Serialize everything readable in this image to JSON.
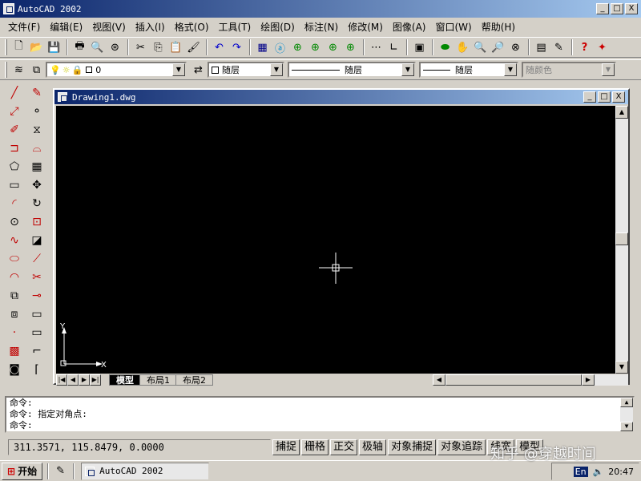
{
  "app": {
    "title": "AutoCAD 2002"
  },
  "window_buttons": {
    "min": "_",
    "max": "□",
    "close": "X"
  },
  "menu": [
    "文件(F)",
    "编辑(E)",
    "视图(V)",
    "插入(I)",
    "格式(O)",
    "工具(T)",
    "绘图(D)",
    "标注(N)",
    "修改(M)",
    "图像(A)",
    "窗口(W)",
    "帮助(H)"
  ],
  "layer": {
    "current": "0",
    "color": "随层",
    "linetype": "随层",
    "lineweight": "随层",
    "plotstyle": "随颜色"
  },
  "drawing": {
    "title": "Drawing1.dwg"
  },
  "axis": {
    "x": "X",
    "y": "Y"
  },
  "tabs": [
    "模型",
    "布局1",
    "布局2"
  ],
  "command_lines": [
    "命令:",
    "命令: 指定对角点:",
    "命令:"
  ],
  "coords": "311.3571, 115.8479, 0.0000",
  "status_buttons": [
    "捕捉",
    "栅格",
    "正交",
    "极轴",
    "对象捕捉",
    "对象追踪",
    "线宽",
    "模型"
  ],
  "taskbar": {
    "start": "开始",
    "task": "AutoCAD 2002",
    "ime": "En",
    "clock": "20:47"
  },
  "watermark": "知乎 @穿越时间"
}
